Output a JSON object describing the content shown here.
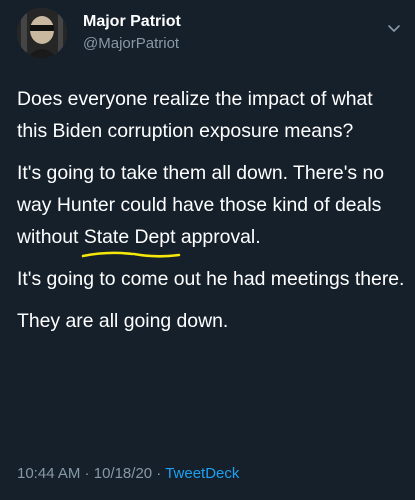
{
  "author": {
    "name": "Major Patriot",
    "handle": "@MajorPatriot"
  },
  "icons": {
    "avatar": "avatar-photo",
    "menu": "chevron-down-icon"
  },
  "colors": {
    "background": "#15202b",
    "text": "#ffffff",
    "muted": "#8899a6",
    "link": "#1da1f2",
    "highlight_underline": "#f5e70a"
  },
  "tweet": {
    "p1": "Does everyone realize the impact of what this Biden corruption exposure means?",
    "p2_text_before": "It's going to take them all down. There's no way Hunter could have those kind of deals without ",
    "p2_state": "State",
    "p2_dept": "Dept",
    "p2_after": " approval.",
    "p3": "It's going to come out he had meetings there.",
    "p4": "They are all going down."
  },
  "meta": {
    "time": "10:44 AM",
    "sep1": " · ",
    "date": "10/18/20",
    "sep2": " · ",
    "source": "TweetDeck"
  }
}
